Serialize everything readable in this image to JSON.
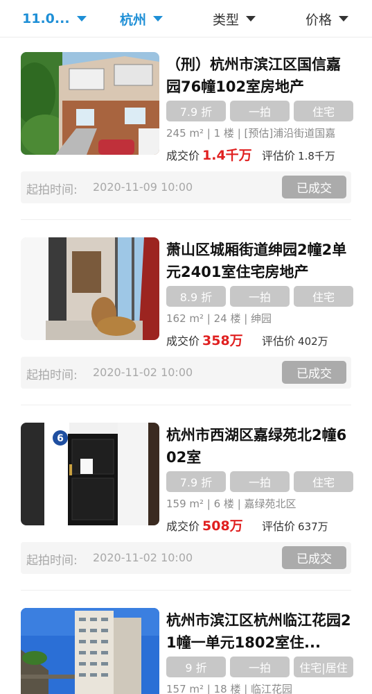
{
  "filters": [
    {
      "label": "11.0...",
      "active": true
    },
    {
      "label": "杭州",
      "active": true
    },
    {
      "label": "类型",
      "active": false
    },
    {
      "label": "价格",
      "active": false
    }
  ],
  "listings": [
    {
      "title": "（刑）杭州市滨江区国信嘉园76幢102室房地产",
      "tags": [
        "7.9 折",
        "一拍",
        "住宅"
      ],
      "meta": "245 m² | 1 楼 | [预估]浦沿街道国嘉",
      "deal_label": "成交价",
      "deal_value": "1.4千万",
      "eval_label": "评估价",
      "eval_value": "1.8千万",
      "start_label": "起拍时间:",
      "start_time": "2020-11-09 10:00",
      "status": "已成交"
    },
    {
      "title": "萧山区城厢街道绅园2幢2单元2401室住宅房地产",
      "tags": [
        "8.9 折",
        "一拍",
        "住宅"
      ],
      "meta": "162 m² | 24 楼 | 绅园",
      "deal_label": "成交价",
      "deal_value": "358万",
      "eval_label": "评估价",
      "eval_value": "402万",
      "start_label": "起拍时间:",
      "start_time": "2020-11-02 10:00",
      "status": "已成交"
    },
    {
      "title": "杭州市西湖区嘉绿苑北2幢602室",
      "tags": [
        "7.9 折",
        "一拍",
        "住宅"
      ],
      "meta": "159 m² | 6 楼 | 嘉绿苑北区",
      "deal_label": "成交价",
      "deal_value": "508万",
      "eval_label": "评估价",
      "eval_value": "637万",
      "start_label": "起拍时间:",
      "start_time": "2020-11-02 10:00",
      "status": "已成交"
    },
    {
      "title": "杭州市滨江区杭州临江花园21幢一单元1802室住...",
      "tags": [
        "9 折",
        "一拍",
        "住宅|居住"
      ],
      "meta": "157 m² | 18 楼 | 临江花园"
    }
  ],
  "door_number": "6"
}
